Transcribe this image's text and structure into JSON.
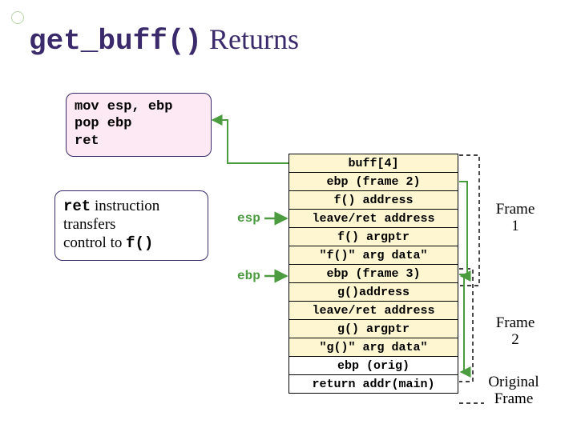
{
  "title": {
    "mono": "get_buff()",
    "rest": " Returns"
  },
  "code": "mov esp, ebp\npop ebp\nret",
  "callout": {
    "p1a": "ret",
    "p1b": " instruction",
    "p2": "transfers",
    "p3a": "control to ",
    "p3b": "f()"
  },
  "pointers": {
    "esp": "esp",
    "ebp": "ebp"
  },
  "stack": [
    {
      "text": "buff[4]",
      "white": false
    },
    {
      "text": "ebp (frame 2)",
      "white": false
    },
    {
      "text": "f() address",
      "white": false
    },
    {
      "text": "leave/ret address",
      "white": false
    },
    {
      "text": "f() argptr",
      "white": false
    },
    {
      "text": "\"f()\" arg data\"",
      "white": false
    },
    {
      "text": "ebp (frame 3)",
      "white": false
    },
    {
      "text": "g()address",
      "white": false
    },
    {
      "text": "leave/ret address",
      "white": false
    },
    {
      "text": "g() argptr",
      "white": false
    },
    {
      "text": "\"g()\" arg data\"",
      "white": false
    },
    {
      "text": "ebp (orig)",
      "white": true
    },
    {
      "text": "return addr(main)",
      "white": true
    }
  ],
  "frames": {
    "f1": "Frame\n1",
    "f2": "Frame\n2",
    "orig": "Original\nFrame"
  }
}
